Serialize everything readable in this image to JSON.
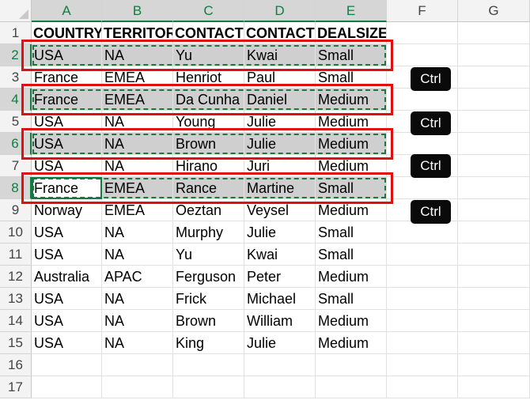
{
  "spreadsheet": {
    "columns": [
      "A",
      "B",
      "C",
      "D",
      "E",
      "F",
      "G"
    ],
    "selected_columns": [
      "A",
      "B",
      "C",
      "D",
      "E"
    ],
    "row_numbers": [
      "1",
      "2",
      "3",
      "4",
      "5",
      "6",
      "7",
      "8",
      "9",
      "10",
      "11",
      "12",
      "13",
      "14",
      "15",
      "16",
      "17"
    ],
    "selected_rows": [
      "2",
      "4",
      "6",
      "8"
    ],
    "active_cell": "A8",
    "rows": [
      [
        "COUNTRY",
        "TERRITORY",
        "CONTACTLASTNAME",
        "CONTACTFIRSTNAME",
        "DEALSIZE"
      ],
      [
        "USA",
        "NA",
        "Yu",
        "Kwai",
        "Small"
      ],
      [
        "France",
        "EMEA",
        "Henriot",
        "Paul",
        "Small"
      ],
      [
        "France",
        "EMEA",
        "Da Cunha",
        "Daniel",
        "Medium"
      ],
      [
        "USA",
        "NA",
        "Young",
        "Julie",
        "Medium"
      ],
      [
        "USA",
        "NA",
        "Brown",
        "Julie",
        "Medium"
      ],
      [
        "USA",
        "NA",
        "Hirano",
        "Juri",
        "Medium"
      ],
      [
        "France",
        "EMEA",
        "Rance",
        "Martine",
        "Small"
      ],
      [
        "Norway",
        "EMEA",
        "Oeztan",
        "Veysel",
        "Medium"
      ],
      [
        "USA",
        "NA",
        "Murphy",
        "Julie",
        "Small"
      ],
      [
        "USA",
        "NA",
        "Yu",
        "Kwai",
        "Small"
      ],
      [
        "Australia",
        "APAC",
        "Ferguson",
        "Peter",
        "Medium"
      ],
      [
        "USA",
        "NA",
        "Frick",
        "Michael",
        "Small"
      ],
      [
        "USA",
        "NA",
        "Brown",
        "William",
        "Medium"
      ],
      [
        "USA",
        "NA",
        "King",
        "Julie",
        "Medium"
      ]
    ]
  },
  "annotations": {
    "ctrl_key_label": "Ctrl",
    "highlight_color": "#e01010",
    "selection_color": "#cfcfcf",
    "accent_color": "#107c41"
  }
}
